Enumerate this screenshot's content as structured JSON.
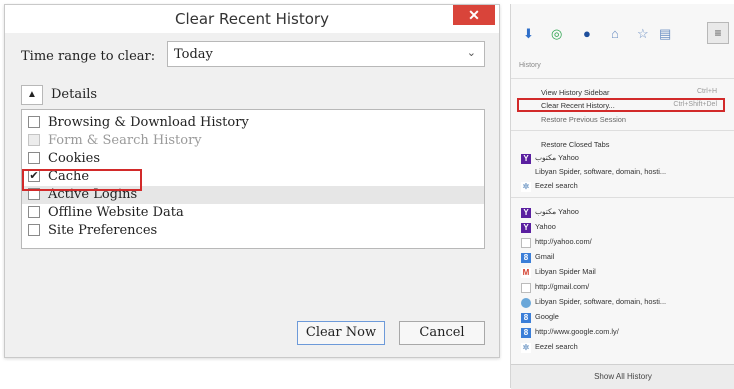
{
  "dialog": {
    "title": "Clear Recent History",
    "close_symbol": "✕",
    "time_range_label": "Time range to clear:",
    "time_range_value": "Today",
    "details_label": "Details",
    "items": [
      {
        "label": "Browsing & Download History",
        "checked": false,
        "disabled": false
      },
      {
        "label": "Form & Search History",
        "checked": false,
        "disabled": true
      },
      {
        "label": "Cookies",
        "checked": false,
        "disabled": false
      },
      {
        "label": "Cache",
        "checked": true,
        "disabled": false
      },
      {
        "label": "Active Logins",
        "checked": false,
        "disabled": false
      },
      {
        "label": "Offline Website Data",
        "checked": false,
        "disabled": false
      },
      {
        "label": "Site Preferences",
        "checked": false,
        "disabled": false
      }
    ],
    "clear_button": "Clear Now",
    "cancel_button": "Cancel"
  },
  "panel": {
    "header": "History",
    "menu": [
      {
        "label": "View History Sidebar",
        "shortcut": "Ctrl+H"
      },
      {
        "label": "Clear Recent History...",
        "shortcut": "Ctrl+Shift+Del"
      },
      {
        "label": "Restore Previous Session",
        "shortcut": ""
      }
    ],
    "restore_closed_tabs": "Restore Closed Tabs",
    "history_items": [
      {
        "icon": "yahoo",
        "label": "مكتوب Yahoo"
      },
      {
        "icon": "eezel",
        "label": "Libyan Spider, software, domain, hosti..."
      },
      {
        "icon": "eezel",
        "label": "Eezel search"
      },
      {
        "icon": "yahoo",
        "label": "مكتوب Yahoo"
      },
      {
        "icon": "yahoo",
        "label": "Yahoo"
      },
      {
        "icon": "page",
        "label": "http://yahoo.com/"
      },
      {
        "icon": "gicon",
        "label": "Gmail"
      },
      {
        "icon": "mail",
        "label": "Libyan Spider Mail"
      },
      {
        "icon": "page",
        "label": "http://gmail.com/"
      },
      {
        "icon": "spider",
        "label": "Libyan Spider, software, domain, hosti..."
      },
      {
        "icon": "gicon",
        "label": "Google"
      },
      {
        "icon": "gicon",
        "label": "http://www.google.com.ly/"
      },
      {
        "icon": "eezel",
        "label": "Eezel search"
      }
    ],
    "show_all": "Show All History"
  }
}
